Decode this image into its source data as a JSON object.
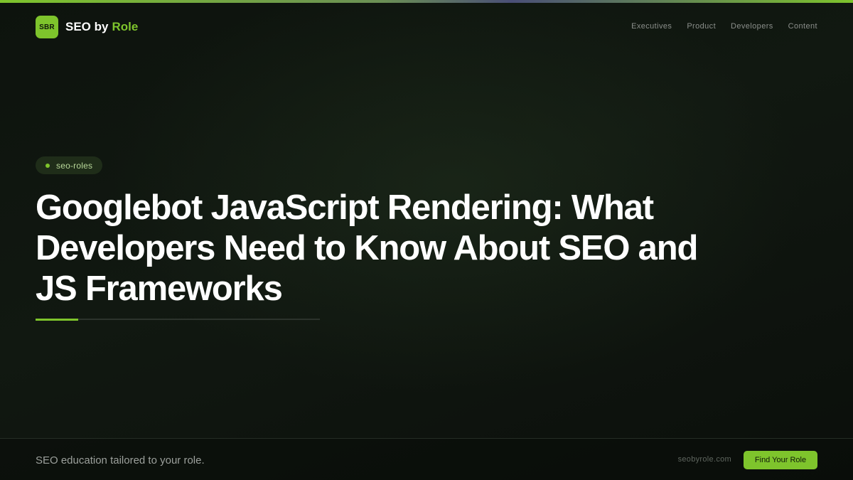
{
  "brand": {
    "badge": "SBR",
    "name_prefix": "SEO by",
    "name_accent": "Role",
    "accent_color": "#7ec42c"
  },
  "nav": {
    "items": [
      {
        "label": "Executives"
      },
      {
        "label": "Product"
      },
      {
        "label": "Developers"
      },
      {
        "label": "Content"
      }
    ]
  },
  "hero": {
    "tag": "seo-roles",
    "title": "Googlebot JavaScript Rendering: What Developers Need to Know About SEO and JS Frameworks"
  },
  "footer": {
    "tagline": "SEO education tailored to your role.",
    "site": "seobyrole.com",
    "cta_label": "Find Your Role"
  }
}
